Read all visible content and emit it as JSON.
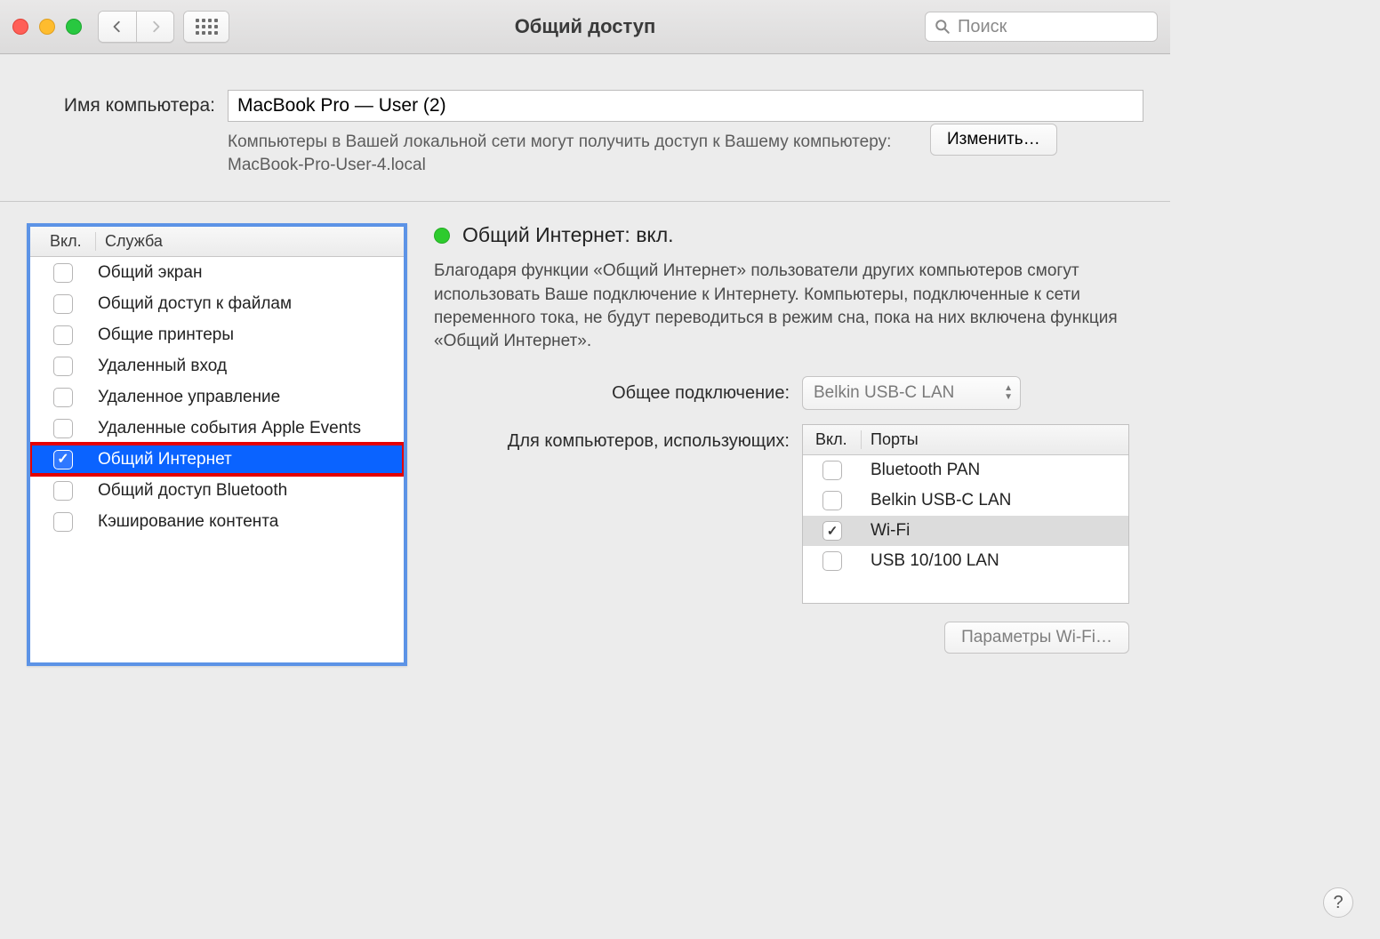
{
  "window": {
    "title": "Общий доступ",
    "search_placeholder": "Поиск"
  },
  "computer_name": {
    "label": "Имя компьютера:",
    "value": "MacBook Pro — User (2)",
    "hint": "Компьютеры в Вашей локальной сети могут получить доступ к Вашему компьютеру: MacBook-Pro-User-4.local",
    "edit_button": "Изменить…"
  },
  "services": {
    "header_on": "Вкл.",
    "header_service": "Служба",
    "items": [
      {
        "label": "Общий экран",
        "checked": false,
        "selected": false
      },
      {
        "label": "Общий доступ к файлам",
        "checked": false,
        "selected": false
      },
      {
        "label": "Общие принтеры",
        "checked": false,
        "selected": false
      },
      {
        "label": "Удаленный вход",
        "checked": false,
        "selected": false
      },
      {
        "label": "Удаленное управление",
        "checked": false,
        "selected": false
      },
      {
        "label": "Удаленные события Apple Events",
        "checked": false,
        "selected": false
      },
      {
        "label": "Общий Интернет",
        "checked": true,
        "selected": true
      },
      {
        "label": "Общий доступ Bluetooth",
        "checked": false,
        "selected": false
      },
      {
        "label": "Кэширование контента",
        "checked": false,
        "selected": false
      }
    ]
  },
  "detail": {
    "status_dot_color": "#2dcb2d",
    "status_text": "Общий Интернет: вкл.",
    "description": "Благодаря функции «Общий Интернет» пользователи других компьютеров смогут использовать Ваше подключение к Интернету. Компьютеры, подключенные к сети переменного тока, не будут переводиться в режим сна, пока на них включена функция «Общий Интернет».",
    "share_from_label": "Общее подключение:",
    "share_from_value": "Belkin USB-C LAN",
    "to_computers_label": "Для компьютеров, использующих:",
    "ports_header_on": "Вкл.",
    "ports_header_name": "Порты",
    "ports": [
      {
        "label": "Bluetooth PAN",
        "checked": false,
        "selected": false
      },
      {
        "label": "Belkin USB-C LAN",
        "checked": false,
        "selected": false
      },
      {
        "label": "Wi-Fi",
        "checked": true,
        "selected": true
      },
      {
        "label": "USB 10/100 LAN",
        "checked": false,
        "selected": false
      }
    ],
    "wifi_options_button": "Параметры Wi-Fi…"
  },
  "help_tooltip": "?"
}
